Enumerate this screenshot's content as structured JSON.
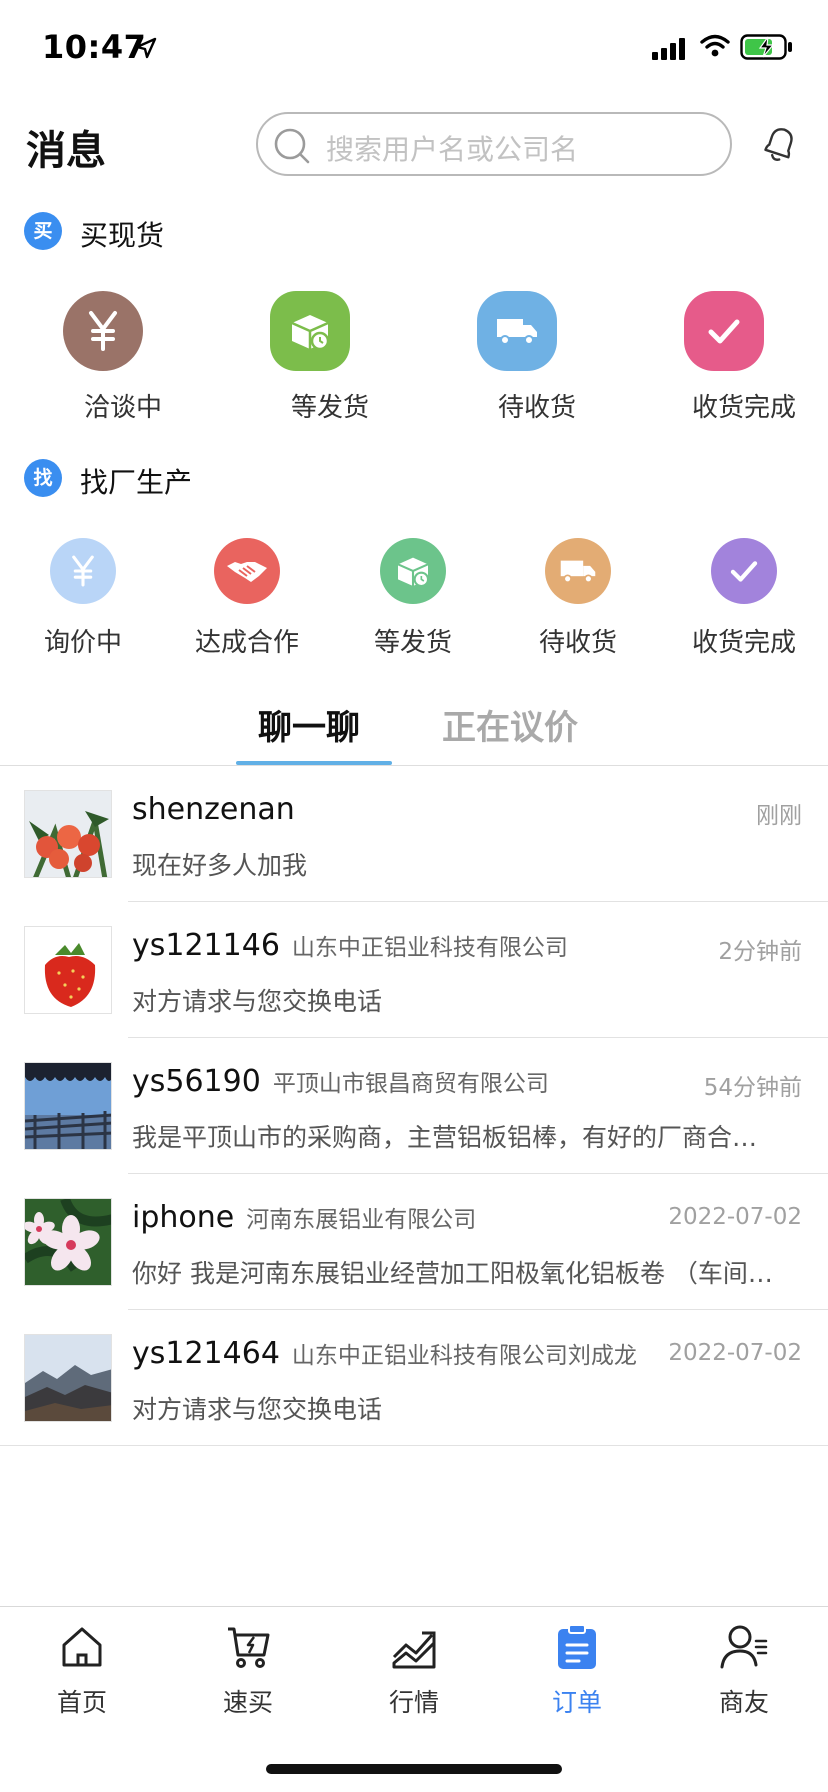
{
  "status_bar": {
    "time": "10:47"
  },
  "header": {
    "title": "消息",
    "search_placeholder": "搜索用户名或公司名"
  },
  "buy_section": {
    "badge": "买",
    "title": "买现货",
    "items": [
      {
        "label": "洽谈中",
        "icon": "yen-icon",
        "color": "#9a7368"
      },
      {
        "label": "等发货",
        "icon": "box-clock-icon",
        "color": "#7cbd4b"
      },
      {
        "label": "待收货",
        "icon": "truck-icon",
        "color": "#6fb1e4"
      },
      {
        "label": "收货完成",
        "icon": "check-icon",
        "color": "#e65b8a"
      }
    ]
  },
  "factory_section": {
    "badge": "找",
    "title": "找厂生产",
    "items": [
      {
        "label": "询价中",
        "icon": "yen-icon",
        "color": "#b9d5f7"
      },
      {
        "label": "达成合作",
        "icon": "handshake-icon",
        "color": "#e9645f"
      },
      {
        "label": "等发货",
        "icon": "box-clock-icon",
        "color": "#6cc48b"
      },
      {
        "label": "待收货",
        "icon": "truck-icon",
        "color": "#e3ac74"
      },
      {
        "label": "收货完成",
        "icon": "check-icon",
        "color": "#a283dc"
      }
    ]
  },
  "tabs": [
    {
      "label": "聊一聊",
      "active": true
    },
    {
      "label": "正在议价",
      "active": false
    }
  ],
  "chats": [
    {
      "name": "shenzenan",
      "company": "",
      "time": "刚刚",
      "message": "现在好多人加我",
      "avatar": "roses-photo"
    },
    {
      "name": "ys121146",
      "company": "山东中正铝业科技有限公司",
      "time": "2分钟前",
      "message": "对方请求与您交换电话",
      "avatar": "strawberry-photo"
    },
    {
      "name": "ys56190",
      "company": "平顶山市银昌商贸有限公司",
      "time": "54分钟前",
      "message": "我是平顶山市的采购商，主营铝板铝棒，有好的厂商合作请联系",
      "avatar": "balcony-photo"
    },
    {
      "name": "iphone",
      "company": "河南东展铝业有限公司",
      "time": "2022-07-02",
      "message": "你好 我是河南东展铝业经营加工阳极氧化铝板卷 （车间直供）",
      "avatar": "flowers-photo"
    },
    {
      "name": "ys121464",
      "company": "山东中正铝业科技有限公司刘成龙",
      "time": "2022-07-02",
      "message": "对方请求与您交换电话",
      "avatar": "mountain-photo"
    }
  ],
  "bottom_nav": [
    {
      "label": "首页",
      "icon": "home-icon",
      "active": false
    },
    {
      "label": "速买",
      "icon": "cart-icon",
      "active": false
    },
    {
      "label": "行情",
      "icon": "trend-icon",
      "active": false
    },
    {
      "label": "订单",
      "icon": "clipboard-icon",
      "active": true
    },
    {
      "label": "商友",
      "icon": "contacts-icon",
      "active": false
    }
  ],
  "colors": {
    "accent": "#3b82f0",
    "tab_underline": "#61b0e6"
  }
}
